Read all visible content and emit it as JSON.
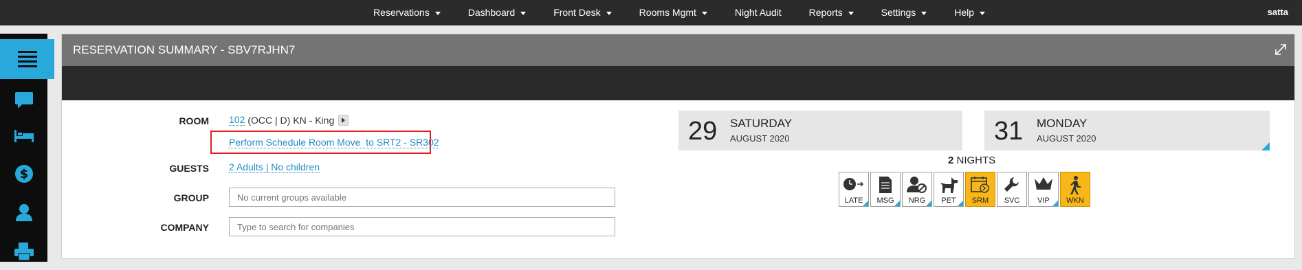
{
  "nav": {
    "items": [
      {
        "label": "Reservations",
        "dropdown": true
      },
      {
        "label": "Dashboard",
        "dropdown": true
      },
      {
        "label": "Front Desk",
        "dropdown": true
      },
      {
        "label": "Rooms Mgmt",
        "dropdown": true
      },
      {
        "label": "Night Audit",
        "dropdown": false
      },
      {
        "label": "Reports",
        "dropdown": true
      },
      {
        "label": "Settings",
        "dropdown": true
      },
      {
        "label": "Help",
        "dropdown": true
      }
    ],
    "user": "satta"
  },
  "sidebar": {
    "items": [
      {
        "icon": "menu-icon"
      },
      {
        "icon": "chat-icon"
      },
      {
        "icon": "bed-icon"
      },
      {
        "icon": "dollar-icon"
      },
      {
        "icon": "user-icon"
      },
      {
        "icon": "print-icon"
      }
    ],
    "accent": "#29a9db"
  },
  "panel": {
    "title": "RESERVATION SUMMARY - SBV7RJHN7"
  },
  "form": {
    "room_label": "ROOM",
    "room_number": "102",
    "room_status": "(OCC | D)",
    "room_type": "KN - King",
    "room_move_link": "Perform Schedule Room Move  to SRT2 - SR302",
    "guests_label": "GUESTS",
    "guests_value": "2 Adults | No children",
    "group_label": "GROUP",
    "group_placeholder": "No current groups available",
    "company_label": "COMPANY",
    "company_placeholder": "Type to search for companies"
  },
  "dates": {
    "arrival": {
      "day": "29",
      "weekday": "SATURDAY",
      "month_year": "AUGUST 2020"
    },
    "departure": {
      "day": "31",
      "weekday": "MONDAY",
      "month_year": "AUGUST 2020"
    },
    "nights_count": "2",
    "nights_label": "NIGHTS"
  },
  "flags": [
    {
      "label": "LATE",
      "icon": "clock-arrow-icon",
      "active": false
    },
    {
      "label": "MSG",
      "icon": "document-icon",
      "active": false
    },
    {
      "label": "NRG",
      "icon": "user-blocked-icon",
      "active": false
    },
    {
      "label": "PET",
      "icon": "dog-icon",
      "active": false
    },
    {
      "label": "SRM",
      "icon": "calendar-arrow-icon",
      "active": true
    },
    {
      "label": "SVC",
      "icon": "wrench-icon",
      "active": false
    },
    {
      "label": "VIP",
      "icon": "crown-icon",
      "active": false
    },
    {
      "label": "WKN",
      "icon": "walking-icon",
      "active": true
    }
  ],
  "colors": {
    "link": "#1f8ac4",
    "flag_active": "#f7b718",
    "highlight_box": "#e02020"
  }
}
